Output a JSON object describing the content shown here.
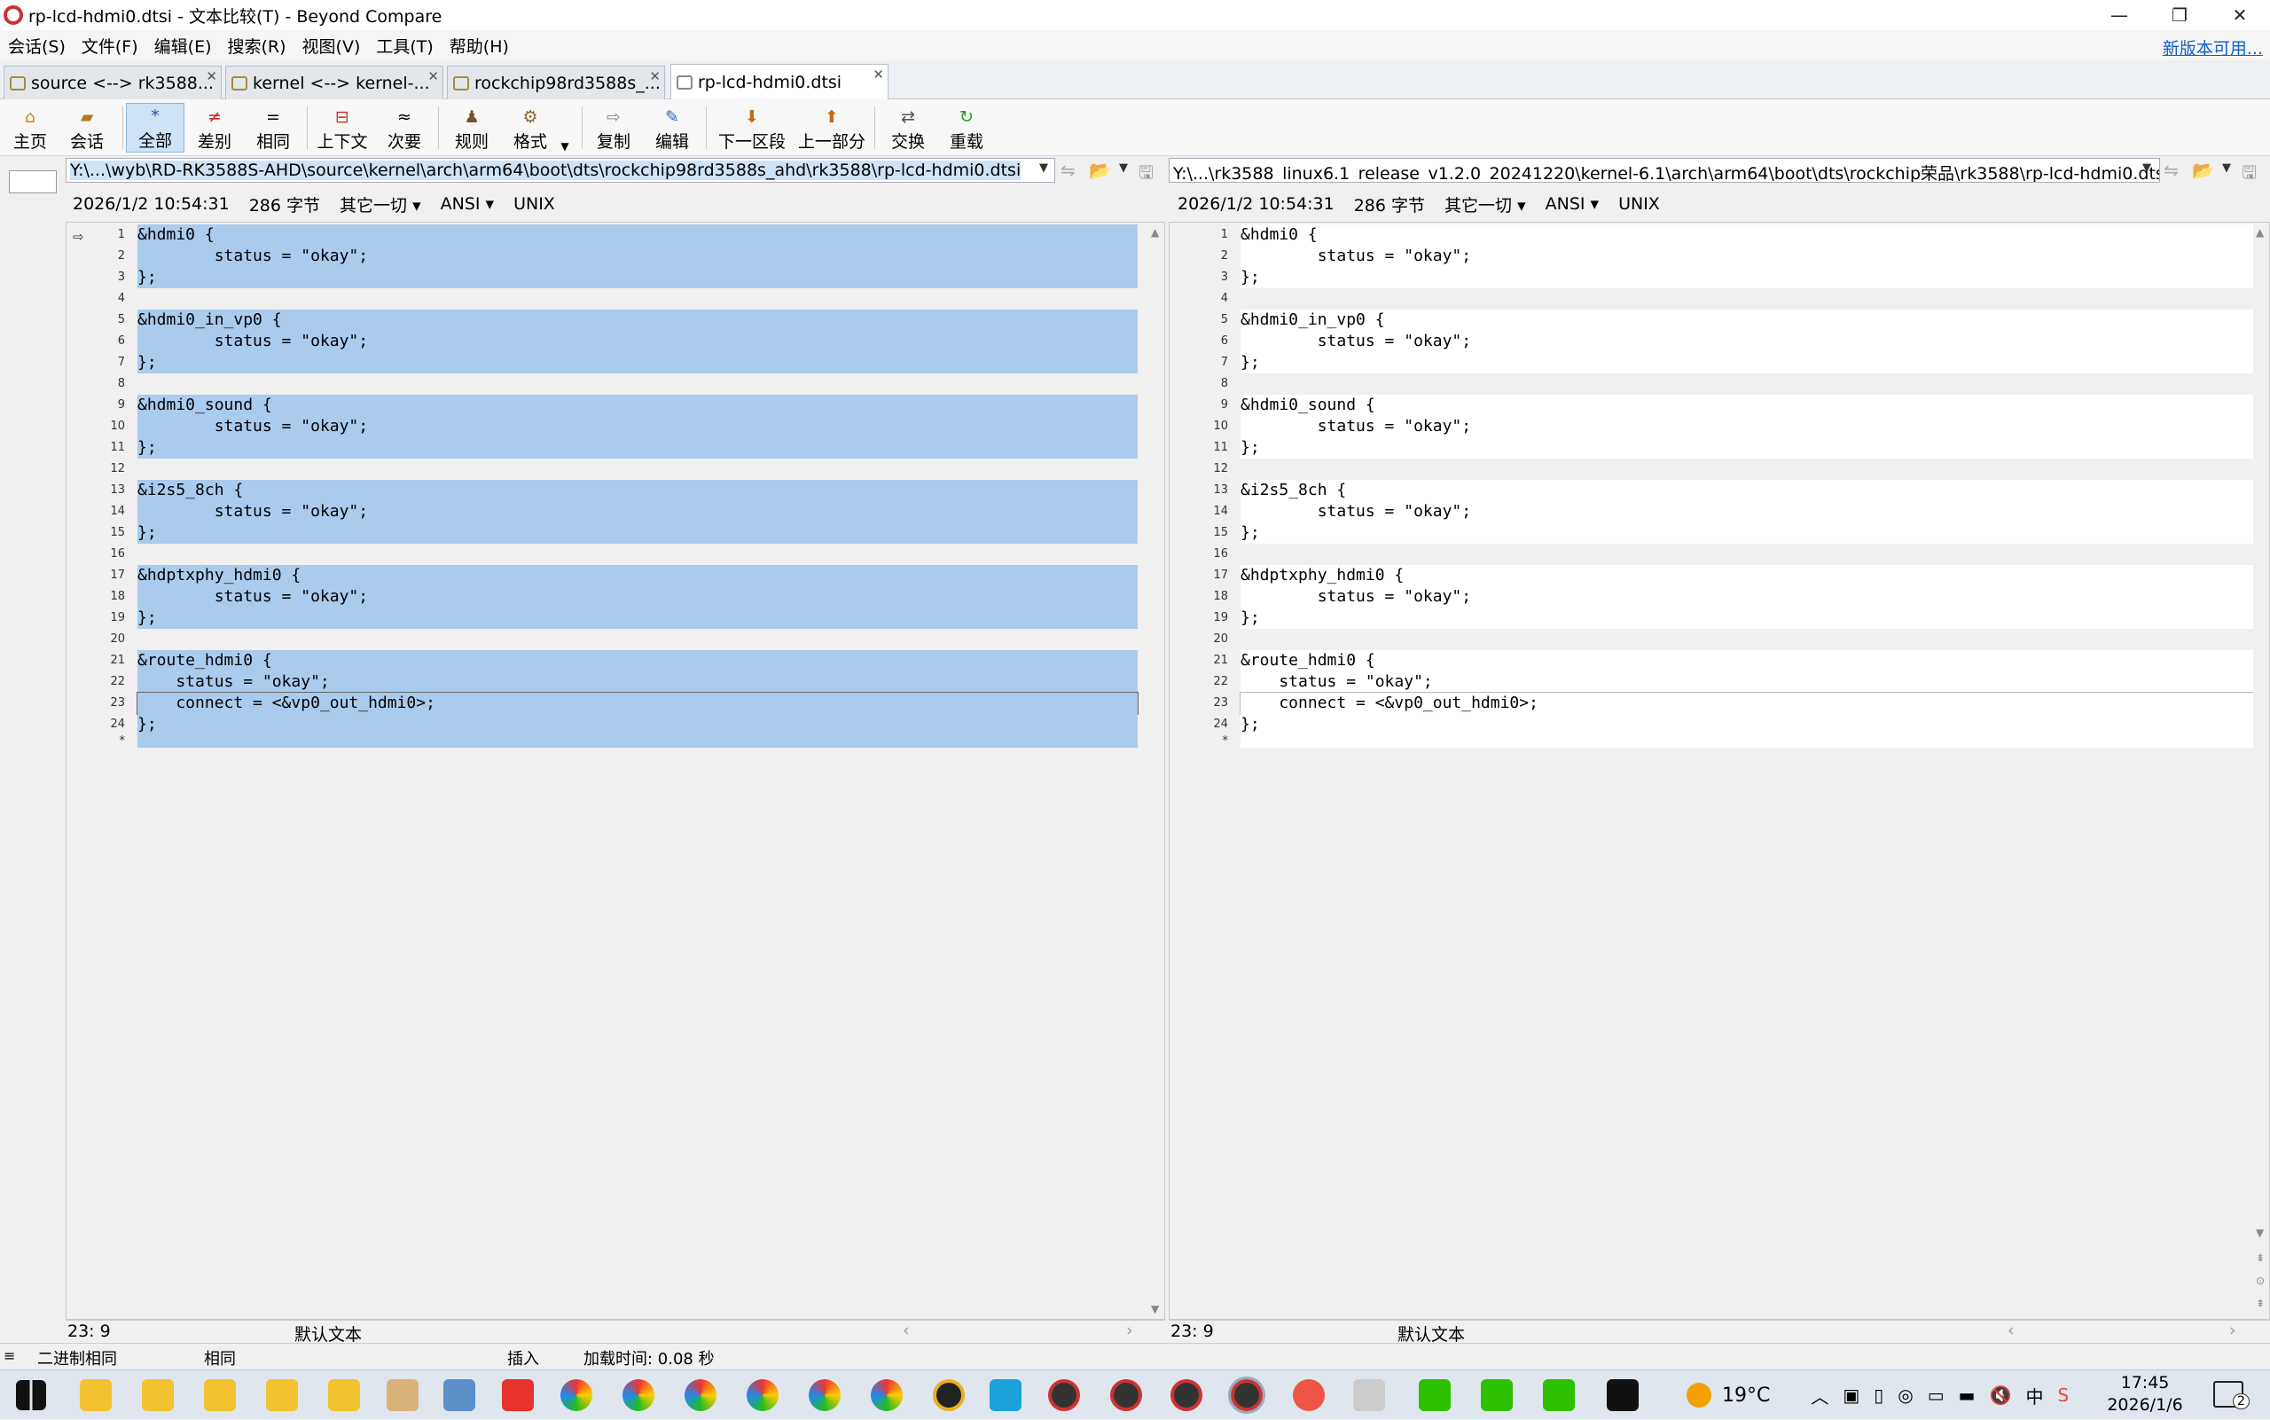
{
  "window": {
    "title": "rp-lcd-hdmi0.dtsi - 文本比较(T) - Beyond Compare",
    "min": "—",
    "max": "❐",
    "close": "✕"
  },
  "menu": {
    "items": [
      "会话(S)",
      "文件(F)",
      "编辑(E)",
      "搜索(R)",
      "视图(V)",
      "工具(T)",
      "帮助(H)"
    ],
    "update_link": "新版本可用..."
  },
  "tabs": [
    "source <--> rk3588...",
    "kernel <--> kernel-...",
    "rockchip98rd3588s_...",
    "rp-lcd-hdmi0.dtsi"
  ],
  "toolbar": {
    "home": "主页",
    "session": "会话",
    "all": "全部",
    "diff": "差别",
    "same": "相同",
    "context": "上下文",
    "minor": "次要",
    "rules": "规则",
    "format": "格式",
    "copy": "复制",
    "edit": "编辑",
    "next_section": "下一区段",
    "prev_part": "上一部分",
    "swap": "交换",
    "reload": "重载"
  },
  "left": {
    "path": "Y:\\...\\wyb\\RD-RK3588S-AHD\\source\\kernel\\arch\\arm64\\boot\\dts\\rockchip98rd3588s_ahd\\rk3588\\rp-lcd-hdmi0.dtsi",
    "date": "2026/1/2 10:54:31",
    "size": "286 字节",
    "other": "其它一切",
    "encoding": "ANSI",
    "eol": "UNIX",
    "cursor": "23: 9",
    "format": "默认文本"
  },
  "right": {
    "path": "Y:\\...\\rk3588_linux6.1_release_v1.2.0_20241220\\kernel-6.1\\arch\\arm64\\boot\\dts\\rockchip荣品\\rk3588\\rp-lcd-hdmi0.dtsi",
    "date": "2026/1/2 10:54:31",
    "size": "286 字节",
    "other": "其它一切",
    "encoding": "ANSI",
    "eol": "UNIX",
    "cursor": "23: 9",
    "format": "默认文本"
  },
  "code_lines": [
    "&hdmi0 {",
    "        status = \"okay\";",
    "};",
    "",
    "&hdmi0_in_vp0 {",
    "        status = \"okay\";",
    "};",
    "",
    "&hdmi0_sound {",
    "        status = \"okay\";",
    "};",
    "",
    "&i2s5_8ch {",
    "        status = \"okay\";",
    "};",
    "",
    "&hdptxphy_hdmi0 {",
    "        status = \"okay\";",
    "};",
    "",
    "&route_hdmi0 {",
    "    status = \"okay\";",
    "    connect = <&vp0_out_hdmi0>;",
    "};"
  ],
  "status": {
    "binary": "二进制相同",
    "same": "相同",
    "insert": "插入",
    "load_time": "加载时间: 0.08 秒"
  },
  "taskbar": {
    "weather": "19°C",
    "time": "17:45",
    "date": "2026/1/6",
    "notif": "2"
  }
}
